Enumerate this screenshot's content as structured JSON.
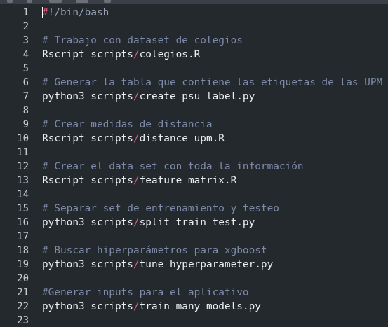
{
  "editor": {
    "lines": [
      {
        "num": "1",
        "kind": "shebang",
        "hash": "#",
        "rest": "!/bin/bash"
      },
      {
        "num": "2",
        "kind": "blank"
      },
      {
        "num": "3",
        "kind": "comment",
        "text": "# Trabajo con dataset de colegios"
      },
      {
        "num": "4",
        "kind": "cmd",
        "pre": "Rscript scripts",
        "sep": "/",
        "post": "colegios.R"
      },
      {
        "num": "5",
        "kind": "blank"
      },
      {
        "num": "6",
        "kind": "comment",
        "text": "# Generar la tabla que contiene las etiquetas de las UPM"
      },
      {
        "num": "7",
        "kind": "cmd",
        "pre": "python3 scripts",
        "sep": "/",
        "post": "create_psu_label.py"
      },
      {
        "num": "8",
        "kind": "blank"
      },
      {
        "num": "9",
        "kind": "comment",
        "text": "# Crear medidas de distancia"
      },
      {
        "num": "10",
        "kind": "cmd",
        "pre": "Rscript scripts",
        "sep": "/",
        "post": "distance_upm.R"
      },
      {
        "num": "11",
        "kind": "blank"
      },
      {
        "num": "12",
        "kind": "comment",
        "text": "# Crear el data set con toda la información"
      },
      {
        "num": "13",
        "kind": "cmd",
        "pre": "Rscript scripts",
        "sep": "/",
        "post": "feature_matrix.R"
      },
      {
        "num": "14",
        "kind": "blank"
      },
      {
        "num": "15",
        "kind": "comment",
        "text": "# Separar set de entrenamiento y testeo"
      },
      {
        "num": "16",
        "kind": "cmd",
        "pre": "python3 scripts",
        "sep": "/",
        "post": "split_train_test.py"
      },
      {
        "num": "17",
        "kind": "blank"
      },
      {
        "num": "18",
        "kind": "comment",
        "text": "# Buscar hiperparámetros para xgboost"
      },
      {
        "num": "19",
        "kind": "cmd",
        "pre": "python3 scripts",
        "sep": "/",
        "post": "tune_hyperparameter.py"
      },
      {
        "num": "20",
        "kind": "blank"
      },
      {
        "num": "21",
        "kind": "comment",
        "text": "#Generar inputs para el aplicativo"
      },
      {
        "num": "22",
        "kind": "cmd",
        "pre": "python3 scripts",
        "sep": "/",
        "post": "train_many_models.py"
      },
      {
        "num": "23",
        "kind": "blank"
      }
    ]
  },
  "theme": {
    "background": "#24292e",
    "comment_color": "#7e8ba8",
    "separator_color": "#f0547e",
    "text_color": "#eceff1",
    "line_number_color": "#c9ccd1"
  }
}
